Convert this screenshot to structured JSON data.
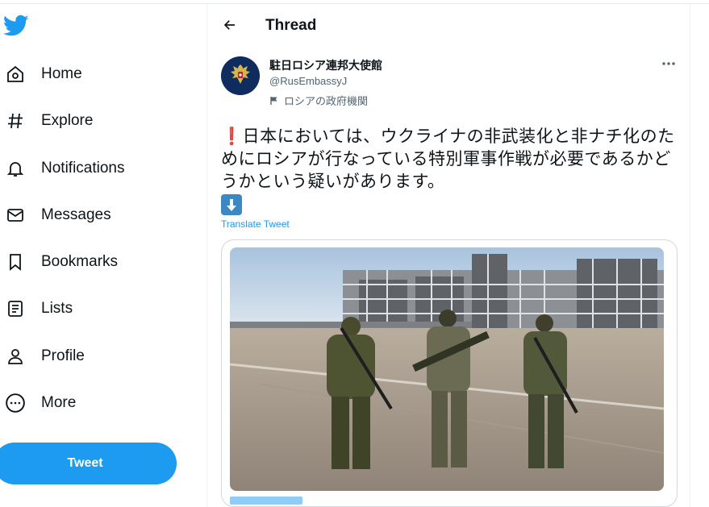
{
  "sidebar": {
    "logo_icon": "twitter-bird-icon",
    "items": [
      {
        "label": "Home",
        "icon": "home-icon"
      },
      {
        "label": "Explore",
        "icon": "hashtag-icon"
      },
      {
        "label": "Notifications",
        "icon": "bell-icon"
      },
      {
        "label": "Messages",
        "icon": "envelope-icon"
      },
      {
        "label": "Bookmarks",
        "icon": "bookmark-icon"
      },
      {
        "label": "Lists",
        "icon": "list-icon"
      },
      {
        "label": "Profile",
        "icon": "person-icon"
      },
      {
        "label": "More",
        "icon": "more-circle-icon"
      }
    ],
    "tweet_button": "Tweet"
  },
  "header": {
    "title": "Thread",
    "back_icon": "arrow-left-icon"
  },
  "tweet": {
    "author_name": "駐日ロシア連邦大使館",
    "author_handle": "@RusEmbassyJ",
    "gov_label": "ロシアの政府機関",
    "text": "❗日本においては、ウクライナの非武装化と非ナチ化のためにロシアが行なっている特別軍事作戦が必要であるかどうかという疑いがあります。",
    "translate_label": "Translate Tweet",
    "emoji_icon": "down-arrow-emoji-icon"
  },
  "colors": {
    "accent": "#1d9bf0",
    "text_primary": "#0f1419",
    "text_secondary": "#536471"
  }
}
